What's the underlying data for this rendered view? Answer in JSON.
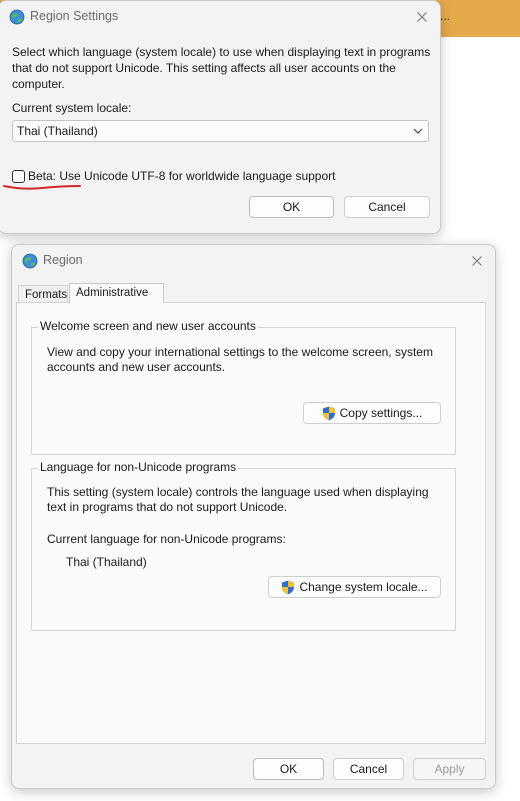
{
  "background_window": {
    "title_fragment": "..."
  },
  "region_settings": {
    "title": "Region Settings",
    "description": [
      "Select which language (system locale) to use when displaying text in programs",
      "that do not support Unicode. This setting affects all user accounts on the",
      "computer."
    ],
    "current_locale_label": "Current system locale:",
    "current_locale_value": "Thai (Thailand)",
    "beta_checkbox_label": "Beta: Use Unicode UTF-8 for worldwide language support",
    "beta_checkbox_checked": false,
    "annotation_color": "#d42a2a",
    "ok_label": "OK",
    "cancel_label": "Cancel"
  },
  "region": {
    "title": "Region",
    "tabs": [
      {
        "label": "Formats",
        "active": false
      },
      {
        "label": "Administrative",
        "active": true
      }
    ],
    "welcome_group": {
      "title": "Welcome screen and new user accounts",
      "description": [
        "View and copy your international settings to the welcome screen, system",
        "accounts and new user accounts."
      ],
      "copy_button_label": "Copy settings..."
    },
    "non_unicode_group": {
      "title": "Language for non-Unicode programs",
      "description": [
        "This setting (system locale) controls the language used when displaying",
        "text in programs that do not support Unicode."
      ],
      "current_label": "Current language for non-Unicode programs:",
      "current_value": "Thai (Thailand)",
      "change_button_label": "Change system locale..."
    },
    "ok_label": "OK",
    "cancel_label": "Cancel",
    "apply_label": "Apply"
  },
  "colors": {
    "background_accent": "#e6a94a",
    "dialog_background": "#f3f3f3",
    "shield_blue": "#2b6fd6",
    "shield_yellow": "#f2c12e"
  },
  "icons": {
    "app_icon": "globe-icon",
    "close": "close-icon",
    "dropdown": "chevron-down-icon",
    "uac": "uac-shield-icon"
  }
}
